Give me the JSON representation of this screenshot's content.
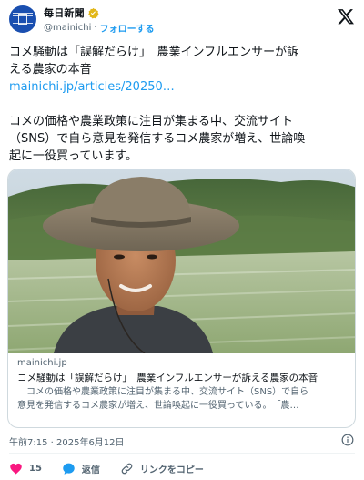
{
  "account": {
    "logo_text": "毎日新聞",
    "display_name": "毎日新聞",
    "handle": "@mainichi",
    "separator": "·",
    "follow_label": "フォローする",
    "brand_color": "#1a4fb0"
  },
  "tweet": {
    "line1": "コメ騒動は「誤解だらけ」　農業インフルエンサーが訴",
    "line2": "える農家の本音",
    "link": "mainichi.jp/articles/20250…",
    "body1": "コメの価格や農業政策に注目が集まる中、交流サイト",
    "body2": "（SNS）で自ら意見を発信するコメ農家が増え、世論喚",
    "body3": "起に一役買っています。"
  },
  "link_card": {
    "domain": "mainichi.jp",
    "title": "コメ騒動は「誤解だらけ」　農業インフルエンサーが訴える農家の本音",
    "desc1": "　コメの価格や農業政策に注目が集まる中、交流サイト（SNS）で自ら",
    "desc2": "意見を発信するコメ農家が増え、世論喚起に一役買っている。　「農…"
  },
  "footer": {
    "timestamp": "午前7:15 · 2025年6月12日",
    "like_count": "15",
    "reply_label": "返信",
    "copy_link_label": "リンクをコピー"
  },
  "colors": {
    "accent": "#1d9bf0",
    "like": "#f91880",
    "text": "#0f1419",
    "muted": "#536471"
  },
  "icons": [
    "verified-badge-icon",
    "x-logo-icon",
    "info-icon",
    "heart-icon",
    "reply-icon",
    "link-icon"
  ]
}
